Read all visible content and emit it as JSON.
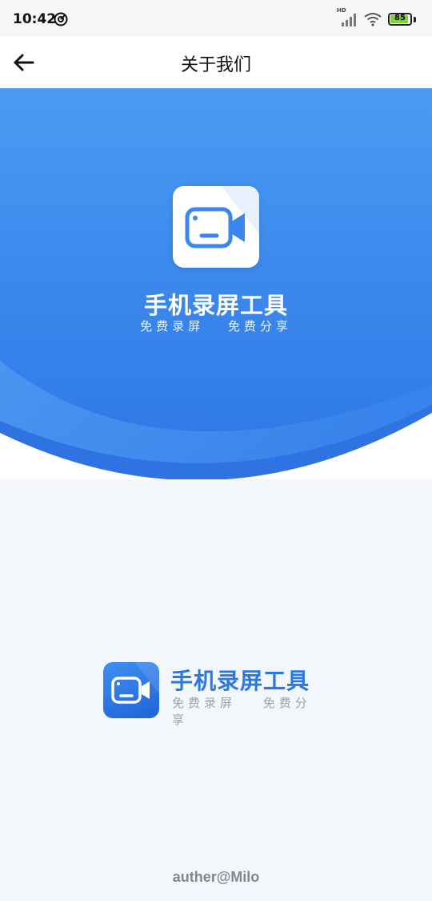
{
  "status_bar": {
    "time": "10:42",
    "network_label": "HD",
    "battery_percent": "85",
    "battery_level": 0.85,
    "battery_color": "#7ed23c",
    "icons": [
      "vpn-icon",
      "signal-icon",
      "wifi-icon",
      "battery-icon"
    ]
  },
  "header": {
    "title": "关于我们",
    "back_icon": "arrow-left-icon"
  },
  "hero": {
    "app_name": "手机录屏工具",
    "slogan_left": "免费录屏",
    "slogan_right": "免费分享",
    "logo_icon": "video-camera-icon",
    "gradient_colors": [
      "#4a9bf4",
      "#2e77e6"
    ]
  },
  "brand": {
    "app_name": "手机录屏工具",
    "slogan_left": "免费录屏",
    "slogan_right": "免费分享",
    "accent": "#2a78e4"
  },
  "footer": {
    "author": "auther@Milo"
  }
}
